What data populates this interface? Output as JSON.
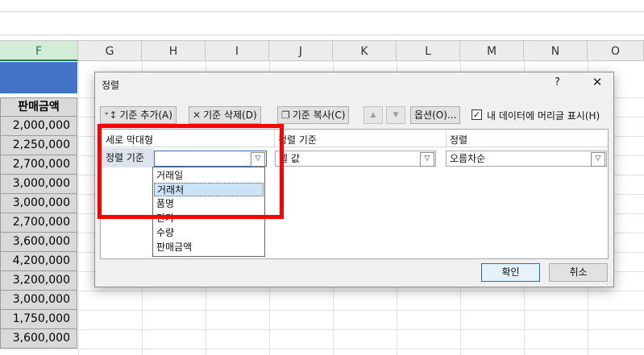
{
  "sheet": {
    "columns": [
      "F",
      "G",
      "H",
      "I",
      "J",
      "K",
      "L",
      "M",
      "N",
      "O"
    ],
    "selected_column": "F",
    "header_cell": "판매금액",
    "values": [
      "2,000,000",
      "2,250,000",
      "2,700,000",
      "3,000,000",
      "3,000,000",
      "2,700,000",
      "3,600,000",
      "4,200,000",
      "3,200,000",
      "3,000,000",
      "1,750,000",
      "3,600,000"
    ]
  },
  "dialog": {
    "title": "정렬",
    "help": "?",
    "close": "✕",
    "toolbar": {
      "add_label": "기준 추가(A)",
      "delete_label": "기준 삭제(D)",
      "copy_label": "기준 복사(C)",
      "options_label": "옵션(O)...",
      "headers_checkbox_label": "내 데이터에 머리글 표시(H)",
      "headers_checked": true
    },
    "columns": {
      "col1": "세로 막대형",
      "col2": "정렬 기준",
      "col3": "정렬"
    },
    "row": {
      "label": "정렬 기준",
      "column_value": "",
      "sort_on_value": "셀 값",
      "order_value": "오름차순"
    },
    "dropdown_items": [
      "거래일",
      "거래처",
      "품명",
      "단가",
      "수량",
      "판매금액"
    ],
    "highlighted_item": "거래처",
    "ok_label": "확인",
    "cancel_label": "취소"
  },
  "colors": {
    "highlight_box": "#ff0000",
    "header_fill": "#4472c4",
    "selected_column": "#217346"
  }
}
